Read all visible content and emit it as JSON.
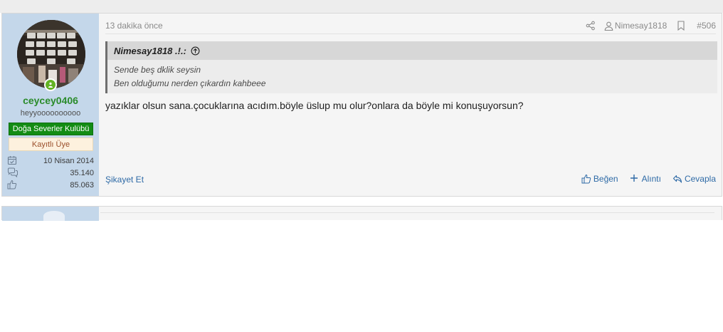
{
  "post": {
    "user": {
      "name": "ceycey0406",
      "title": "heyyoooooooooo",
      "banners": [
        "Doğa Severler Kulübü",
        "Kayıtlı Üye"
      ],
      "stats": [
        {
          "icon": "calendar-check-icon",
          "value": "10 Nisan 2014"
        },
        {
          "icon": "comments-icon",
          "value": "35.140"
        },
        {
          "icon": "thumbs-up-icon",
          "value": "85.063"
        }
      ],
      "online": true
    },
    "time": "13 dakika önce",
    "author_ref": "Nimesay1818",
    "post_number": "#506",
    "quote": {
      "author": "Nimesay1818 .!.:",
      "lines": [
        "Sende beş dklik seysin",
        "Ben olduğumu nerden çıkardın kahbeee"
      ]
    },
    "message": "yazıklar olsun sana.çocuklarına acıdım.böyle üslup mu olur?onlara da böyle mi konuşuyorsun?",
    "report_label": "Şikayet Et",
    "actions": {
      "like": "Beğen",
      "quote": "Alıntı",
      "reply": "Cevapla"
    }
  },
  "colors": {
    "user_panel": "#c4d7ea",
    "username": "#2a8b2a",
    "banner_green": "#138c14",
    "banner_light": "#fdf1de",
    "link": "#2e6aa6",
    "online": "#63b324"
  }
}
